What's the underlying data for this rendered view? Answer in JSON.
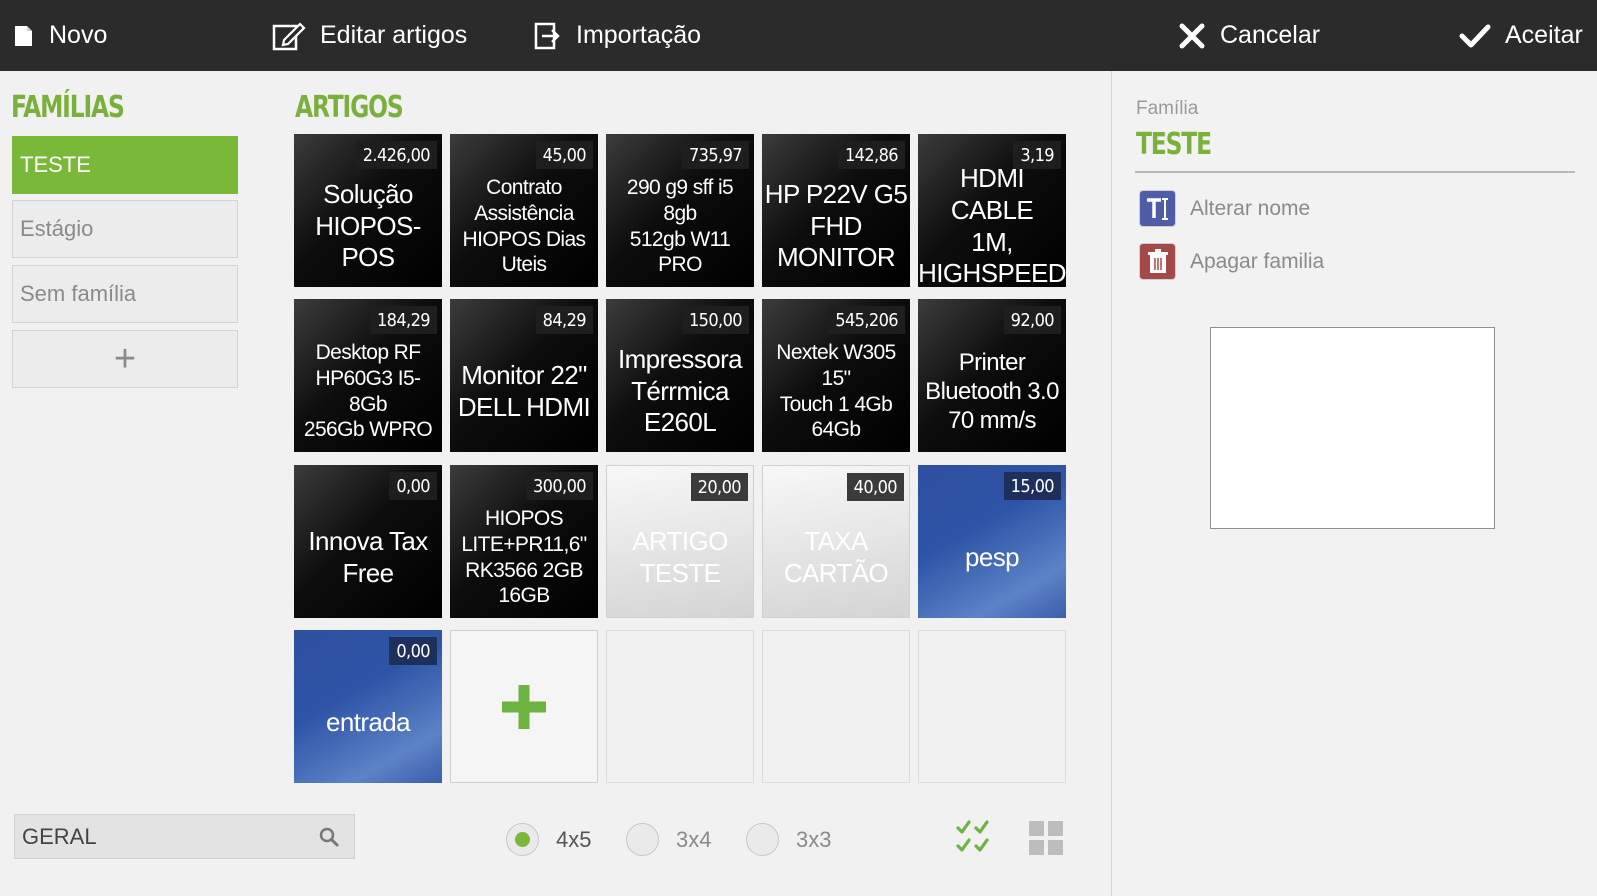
{
  "toolbar": {
    "novo": "Novo",
    "editar": "Editar artigos",
    "importacao": "Importação",
    "cancelar": "Cancelar",
    "aceitar": "Aceitar"
  },
  "familias": {
    "title": "FAMÍLIAS",
    "items": [
      "TESTE",
      "Estágio",
      "Sem família"
    ],
    "selected": "TESTE",
    "add_label": "+"
  },
  "artigos": {
    "title": "ARTIGOS",
    "tiles": [
      {
        "price": "2.426,00",
        "name": [
          "Solução",
          "HIOPOS-POS"
        ],
        "style": "dark"
      },
      {
        "price": "45,00",
        "name": [
          "Contrato",
          "Assistência",
          "HIOPOS Dias",
          "Uteis"
        ],
        "style": "dark"
      },
      {
        "price": "735,97",
        "name": [
          "290 g9 sff i5 8gb",
          "512gb W11 PRO"
        ],
        "style": "dark"
      },
      {
        "price": "142,86",
        "name": [
          "HP P22V G5",
          "FHD",
          "MONITOR"
        ],
        "style": "dark"
      },
      {
        "price": "3,19",
        "name": [
          "HDMI CABLE",
          "1M,",
          "HIGHSPEED"
        ],
        "style": "dark"
      },
      {
        "price": "184,29",
        "name": [
          "Desktop RF",
          "HP60G3 I5-  8Gb",
          "256Gb WPRO"
        ],
        "style": "dark"
      },
      {
        "price": "84,29",
        "name": [
          "Monitor 22\"",
          "DELL HDMI"
        ],
        "style": "dark"
      },
      {
        "price": "150,00",
        "name": [
          "Impressora",
          "Térrmica",
          "E260L"
        ],
        "style": "dark"
      },
      {
        "price": "545,206",
        "name": [
          "Nextek W305 15\"",
          "Touch 1 4Gb",
          "64Gb"
        ],
        "style": "dark"
      },
      {
        "price": "92,00",
        "name": [
          "Printer",
          "Bluetooth 3.0",
          "70 mm/s"
        ],
        "style": "dark"
      },
      {
        "price": "0,00",
        "name": [
          "Innova Tax",
          "Free"
        ],
        "style": "dark"
      },
      {
        "price": "300,00",
        "name": [
          "HIOPOS",
          "LITE+PR11,6\"",
          "RK3566 2GB",
          "16GB"
        ],
        "style": "dark"
      },
      {
        "price": "20,00",
        "name": [
          "ARTIGO TESTE"
        ],
        "style": "light"
      },
      {
        "price": "40,00",
        "name": [
          "TAXA CARTÃO"
        ],
        "style": "light"
      },
      {
        "price": "15,00",
        "name": [
          "pesp"
        ],
        "style": "blue"
      },
      {
        "price": "0,00",
        "name": [
          "entrada"
        ],
        "style": "blue"
      }
    ]
  },
  "search": {
    "value": "GERAL"
  },
  "layout_options": [
    "4x5",
    "3x4",
    "3x3"
  ],
  "layout_selected": "4x5",
  "panel": {
    "label": "Família",
    "name": "TESTE",
    "rename": "Alterar nome",
    "delete": "Apagar familia"
  },
  "colors": {
    "accent_green": "#7ab83a",
    "topbar": "#2b2b2b",
    "tile_blue": "#2e54a7"
  }
}
